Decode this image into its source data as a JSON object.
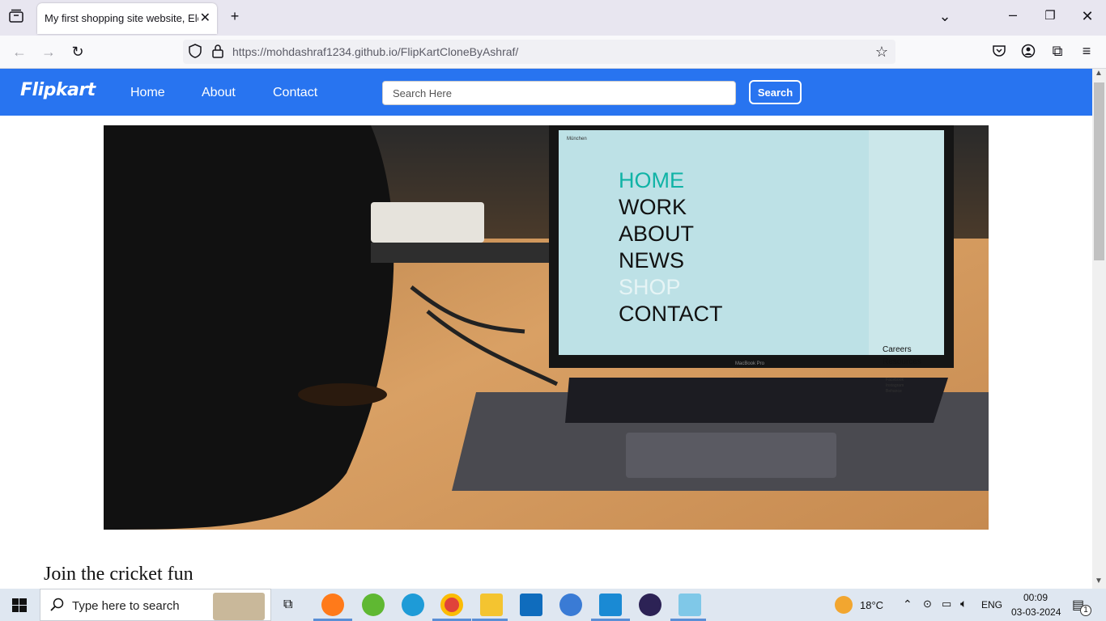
{
  "browser": {
    "tab_title": "My first shopping site website, Elect",
    "url_host": "https://mohdashraf1234.github.io",
    "url_path": "/FlipKartCloneByAshraf/"
  },
  "site": {
    "logo": "Flipkart",
    "nav": [
      "Home",
      "About",
      "Contact"
    ],
    "search_placeholder": "Search Here",
    "search_button": "Search",
    "section_heading": "Join the cricket fun"
  },
  "hero_screen": {
    "menu": [
      "HOME",
      "WORK",
      "ABOUT",
      "NEWS",
      "SHOP",
      "CONTACT"
    ],
    "side_links": [
      "Careers",
      "Resources"
    ],
    "social": [
      "Facebook",
      "Instagram",
      "Behance"
    ],
    "city": "München",
    "laptop_label": "MacBook Pro"
  },
  "taskbar": {
    "search_text": "Type here to search",
    "weather": "18°C",
    "language": "ENG",
    "time": "00:09",
    "date": "03-03-2024",
    "notifications": "1"
  },
  "colors": {
    "brand": "#2874f0"
  }
}
